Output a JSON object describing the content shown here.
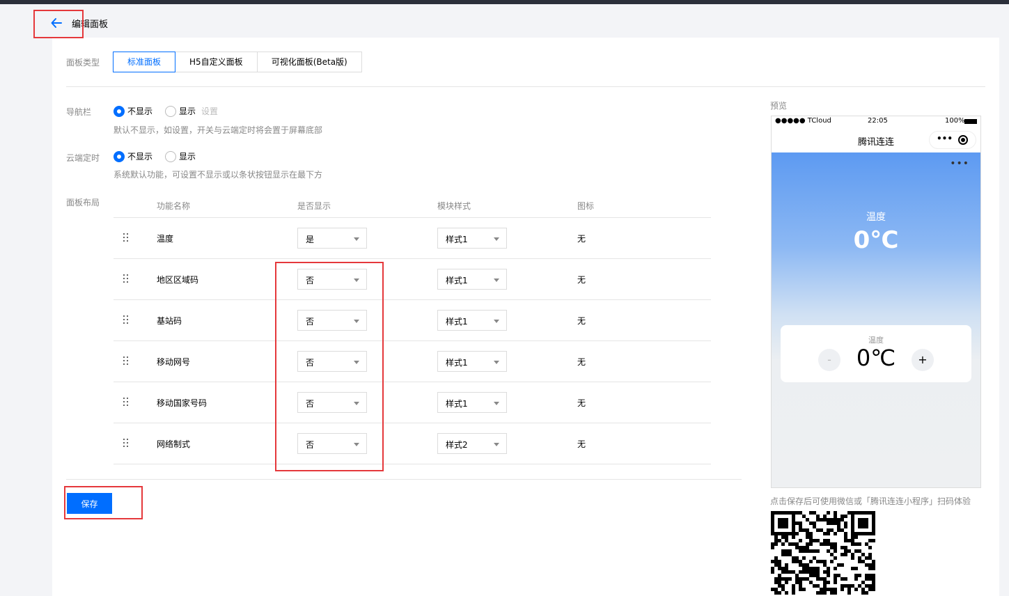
{
  "header": {
    "title": "编辑面板"
  },
  "panel_type": {
    "label": "面板类型",
    "tabs": [
      {
        "label": "标准面板",
        "active": true
      },
      {
        "label": "H5自定义面板",
        "active": false
      },
      {
        "label": "可视化面板(Beta版)",
        "active": false
      }
    ]
  },
  "navbar": {
    "label": "导航栏",
    "options": [
      "不显示",
      "显示"
    ],
    "selected": "不显示",
    "setting_link": "设置",
    "hint": "默认不显示，如设置，开关与云端定时将会置于屏幕底部"
  },
  "cloud_timer": {
    "label": "云端定时",
    "options": [
      "不显示",
      "显示"
    ],
    "selected": "不显示",
    "hint": "系统默认功能，可设置不显示或以条状按钮显示在最下方"
  },
  "layout": {
    "label": "面板布局",
    "columns": [
      "功能名称",
      "是否显示",
      "模块样式",
      "图标"
    ],
    "rows": [
      {
        "name": "温度",
        "show": "是",
        "style": "样式1",
        "icon": "无"
      },
      {
        "name": "地区区域码",
        "show": "否",
        "style": "样式1",
        "icon": "无"
      },
      {
        "name": "基站码",
        "show": "否",
        "style": "样式1",
        "icon": "无"
      },
      {
        "name": "移动网号",
        "show": "否",
        "style": "样式1",
        "icon": "无"
      },
      {
        "name": "移动国家号码",
        "show": "否",
        "style": "样式1",
        "icon": "无"
      },
      {
        "name": "网络制式",
        "show": "否",
        "style": "样式2",
        "icon": "无"
      }
    ]
  },
  "save_label": "保存",
  "preview": {
    "label": "预览",
    "status_carrier": "●●●●● TCloud",
    "status_time": "22:05",
    "status_battery": "100%",
    "nav_title": "腾讯连连",
    "more_dots": "•••",
    "hero_label": "温度",
    "hero_value": "0℃",
    "control_label": "温度",
    "control_value": "0℃",
    "minus": "-",
    "plus": "+"
  },
  "qr_caption": "点击保存后可使用微信或「腾讯连连小程序」扫码体验",
  "colors": {
    "accent": "#006eff",
    "highlight": "#e5383b"
  }
}
